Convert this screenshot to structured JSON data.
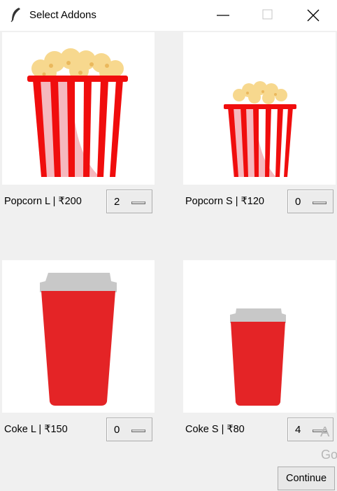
{
  "window": {
    "title": "Select Addons",
    "icon": "feather-icon"
  },
  "items": [
    {
      "label": "Popcorn L | ₹200",
      "quantity": "2",
      "image": "popcorn-large"
    },
    {
      "label": "Popcorn S | ₹120",
      "quantity": "0",
      "image": "popcorn-small"
    },
    {
      "label": "Coke L | ₹150",
      "quantity": "0",
      "image": "coke-large"
    },
    {
      "label": "Coke S | ₹80",
      "quantity": "4",
      "image": "coke-small"
    }
  ],
  "continue_label": "Continue",
  "watermark": {
    "line1": "A",
    "line2": "Go"
  },
  "colors": {
    "popcorn_red": "#f00d0d",
    "cup_red": "#e42426",
    "lid_gray": "#c8c8c8",
    "popcorn_yellow": "#f7d88e"
  }
}
